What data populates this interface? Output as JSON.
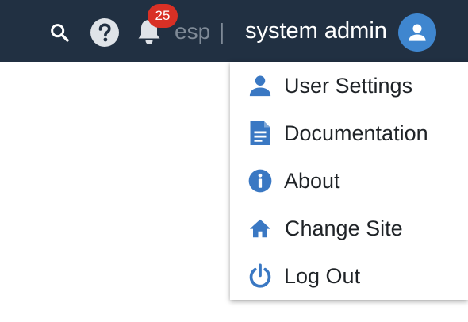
{
  "header": {
    "search_icon": "search-icon",
    "help_icon": "help-circle-icon",
    "notifications_icon": "bell-icon",
    "notification_count": "25",
    "site_code": "esp",
    "separator": "|",
    "user_name": "system admin",
    "avatar_icon": "user-icon",
    "colors": {
      "bar_background": "#213042",
      "badge": "#d93025",
      "avatar": "#3f86cf",
      "muted_text": "#7f8a97",
      "accent": "#3a78c3"
    }
  },
  "user_menu": {
    "items": [
      {
        "label": "User Settings",
        "icon": "user-icon"
      },
      {
        "label": "Documentation",
        "icon": "document-icon"
      },
      {
        "label": "About",
        "icon": "info-icon"
      },
      {
        "label": "Change Site",
        "icon": "home-icon"
      },
      {
        "label": "Log Out",
        "icon": "power-icon"
      }
    ]
  }
}
